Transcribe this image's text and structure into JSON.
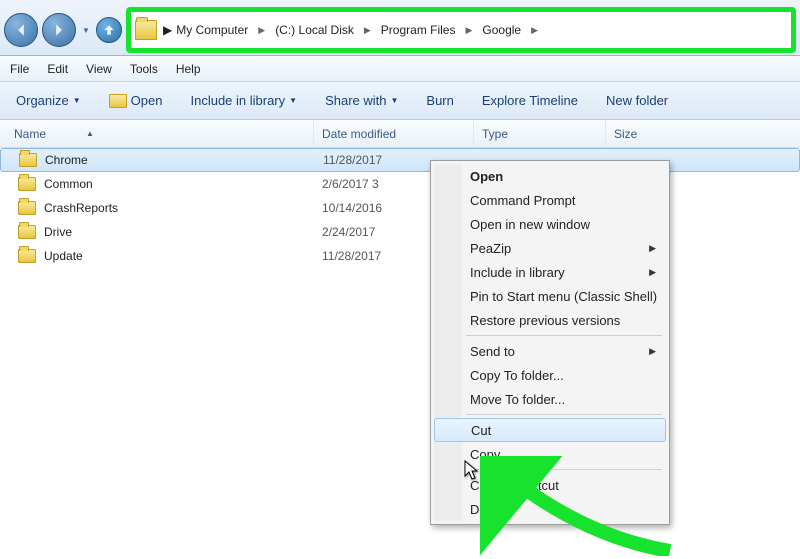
{
  "breadcrumb": {
    "segments": [
      "My Computer",
      "(C:) Local Disk",
      "Program Files",
      "Google"
    ]
  },
  "menu": {
    "file": "File",
    "edit": "Edit",
    "view": "View",
    "tools": "Tools",
    "help": "Help"
  },
  "toolbar": {
    "organize": "Organize",
    "open": "Open",
    "include": "Include in library",
    "share": "Share with",
    "burn": "Burn",
    "explore": "Explore Timeline",
    "newfolder": "New folder"
  },
  "columns": {
    "name": "Name",
    "date": "Date modified",
    "type": "Type",
    "size": "Size"
  },
  "files": [
    {
      "name": "Chrome",
      "date": "11/28/2017",
      "selected": true
    },
    {
      "name": "Common",
      "date": "2/6/2017 3"
    },
    {
      "name": "CrashReports",
      "date": "10/14/2016"
    },
    {
      "name": "Drive",
      "date": "2/24/2017"
    },
    {
      "name": "Update",
      "date": "11/28/2017"
    }
  ],
  "contextMenu": {
    "open": "Open",
    "cmdprompt": "Command Prompt",
    "newwindow": "Open in new window",
    "peazip": "PeaZip",
    "include": "Include in library",
    "pin": "Pin to Start menu (Classic Shell)",
    "restore": "Restore previous versions",
    "sendto": "Send to",
    "copyto": "Copy To folder...",
    "moveto": "Move To folder...",
    "cut": "Cut",
    "copy": "Copy",
    "shortcut": "Create shortcut",
    "delete": "Delete"
  }
}
